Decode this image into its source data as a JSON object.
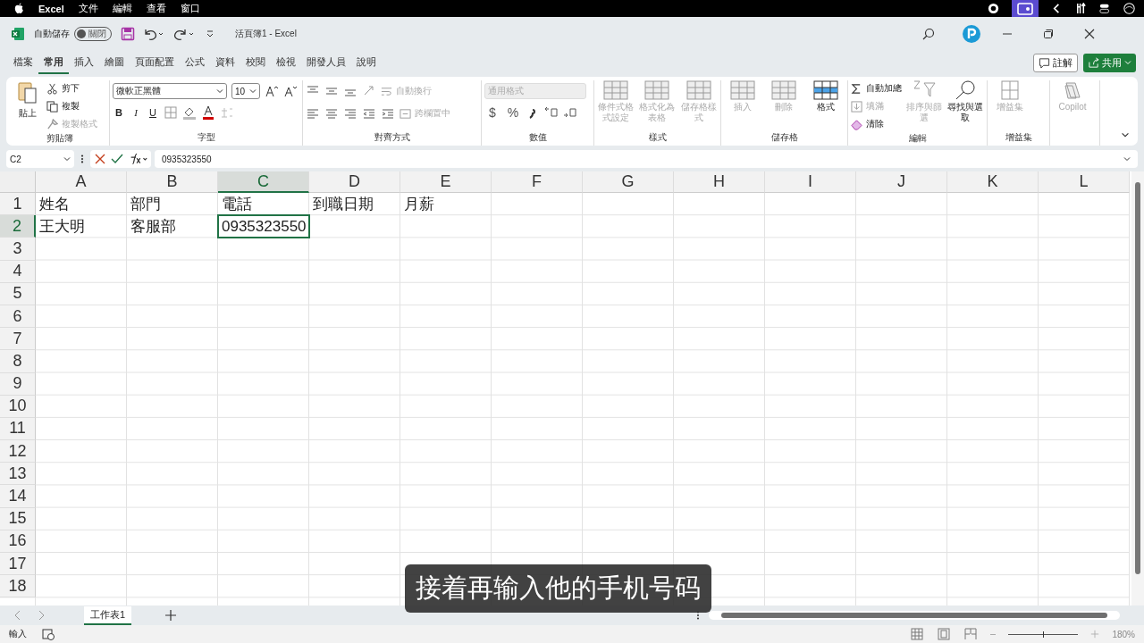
{
  "menu_bar": {
    "app": "Excel",
    "items": [
      "文件",
      "編輯",
      "查看",
      "窗口"
    ]
  },
  "title_bar": {
    "autosave_label": "自動儲存",
    "autosave": {
      "on": false,
      "label": "關閉"
    },
    "title": "活頁簿1  -  Excel"
  },
  "tabs": [
    {
      "label": "檔案",
      "selected": false
    },
    {
      "label": "常用",
      "selected": true
    },
    {
      "label": "插入",
      "selected": false
    },
    {
      "label": "繪圖",
      "selected": false
    },
    {
      "label": "頁面配置",
      "selected": false
    },
    {
      "label": "公式",
      "selected": false
    },
    {
      "label": "資料",
      "selected": false
    },
    {
      "label": "校閱",
      "selected": false
    },
    {
      "label": "檢視",
      "selected": false
    },
    {
      "label": "開發人員",
      "selected": false
    },
    {
      "label": "說明",
      "selected": false
    }
  ],
  "comment_button": "註解",
  "share_button": "共用",
  "ribbon": {
    "clipboard": {
      "name": "剪貼簿",
      "paste": "貼上",
      "cut": "剪下",
      "copy": "複製",
      "format_painter": {
        "label": "複製格式",
        "disabled": true
      }
    },
    "font": {
      "name": "字型",
      "font_family": "微軟正黑體",
      "font_size": "10",
      "bold": "B",
      "italic": "I",
      "underline": "U"
    },
    "alignment": {
      "name": "對齊方式",
      "wrap_text": {
        "label": "自動換行",
        "disabled": true
      },
      "merge": {
        "label": "跨欄置中",
        "disabled": true
      }
    },
    "number": {
      "name": "數值",
      "format": {
        "value": "通用格式",
        "disabled": true
      },
      "currency": "$",
      "percent": "%"
    },
    "styles": {
      "name": "樣式",
      "buttons": [
        {
          "label": "條件式格式設定",
          "disabled": true
        },
        {
          "label": "格式化為表格",
          "disabled": true
        },
        {
          "label": "儲存格樣式",
          "disabled": true
        }
      ]
    },
    "cells": {
      "name": "儲存格",
      "buttons": [
        {
          "label": "插入",
          "disabled": true
        },
        {
          "label": "刪除",
          "disabled": true
        },
        {
          "label": "格式",
          "disabled": false
        }
      ]
    },
    "editing": {
      "name": "編輯",
      "autosum": {
        "label": "自動加總",
        "disabled": false
      },
      "fill": {
        "label": "填滿",
        "disabled": true
      },
      "clear": {
        "label": "清除",
        "disabled": false
      },
      "sort": {
        "label": "排序與篩選",
        "disabled": true
      },
      "find": {
        "label": "尋找與選取",
        "disabled": false
      }
    },
    "addins": {
      "name": "增益集",
      "buttons": [
        {
          "label": "增益集",
          "disabled": true
        },
        {
          "label": "Copilot",
          "disabled": true
        }
      ]
    }
  },
  "formula_bar": {
    "name_box": "C2",
    "value": "0935323550"
  },
  "sheet": {
    "columns": [
      {
        "label": "A",
        "selected": false
      },
      {
        "label": "B",
        "selected": false
      },
      {
        "label": "C",
        "selected": true
      },
      {
        "label": "D",
        "selected": false
      },
      {
        "label": "E",
        "selected": false
      },
      {
        "label": "F",
        "selected": false
      },
      {
        "label": "G",
        "selected": false
      },
      {
        "label": "H",
        "selected": false
      },
      {
        "label": "I",
        "selected": false
      },
      {
        "label": "J",
        "selected": false
      },
      {
        "label": "K",
        "selected": false
      },
      {
        "label": "L",
        "selected": false
      }
    ],
    "rows": [
      {
        "label": "1",
        "selected": false,
        "cells": [
          "姓名",
          "部門",
          "電話",
          "到職日期",
          "月薪"
        ]
      },
      {
        "label": "2",
        "selected": true,
        "cells": [
          "王大明",
          "客服部",
          "0935323550"
        ]
      },
      {
        "label": "3",
        "selected": false
      },
      {
        "label": "4",
        "selected": false
      },
      {
        "label": "5",
        "selected": false
      },
      {
        "label": "6",
        "selected": false
      },
      {
        "label": "7",
        "selected": false
      },
      {
        "label": "8",
        "selected": false
      },
      {
        "label": "9",
        "selected": false
      },
      {
        "label": "10",
        "selected": false
      },
      {
        "label": "11",
        "selected": false
      },
      {
        "label": "12",
        "selected": false
      },
      {
        "label": "13",
        "selected": false
      },
      {
        "label": "14",
        "selected": false
      },
      {
        "label": "15",
        "selected": false
      },
      {
        "label": "16",
        "selected": false
      },
      {
        "label": "17",
        "selected": false
      },
      {
        "label": "18",
        "selected": false
      }
    ]
  },
  "sheet_tabs": [
    {
      "label": "工作表1",
      "selected": true
    }
  ],
  "status_bar": {
    "mode": "輸入",
    "zoom": {
      "label": "180%",
      "level": 0.5
    }
  },
  "caption": "接着再输入他的手机号码"
}
